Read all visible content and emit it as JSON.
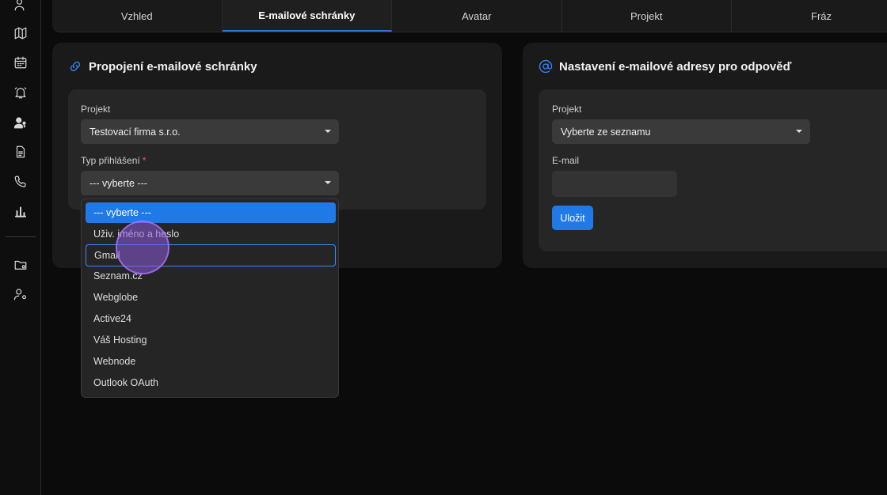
{
  "tabs": [
    {
      "label": "Vzhled",
      "active": false
    },
    {
      "label": "E-mailové schránky",
      "active": true
    },
    {
      "label": "Avatar",
      "active": false
    },
    {
      "label": "Projekt",
      "active": false
    },
    {
      "label": "Fráz",
      "active": false
    }
  ],
  "sidebar": {
    "icons": [
      "user-icon",
      "map-icon",
      "calendar-icon",
      "bell-icon",
      "user-key-icon",
      "document-icon",
      "phone-icon",
      "bar-chart-icon",
      "folder-settings-icon",
      "user-settings-icon"
    ]
  },
  "left_card": {
    "title": "Propojení e-mailové schránky",
    "project_label": "Projekt",
    "project_value": "Testovací firma s.r.o.",
    "login_type_label": "Typ přihlášení",
    "required_mark": "*",
    "login_type_value": "--- vyberte ---"
  },
  "dropdown": {
    "options": [
      "--- vyberte ---",
      "Uživ. jméno a heslo",
      "Gmail",
      "Seznam.cz",
      "Webglobe",
      "Active24",
      "Váš Hosting",
      "Webnode",
      "Outlook OAuth"
    ],
    "selected_index": 0,
    "focused_index": 2
  },
  "right_card": {
    "title": "Nastavení e-mailové adresy pro odpověď",
    "project_label": "Projekt",
    "project_value": "Vyberte ze seznamu",
    "email_label": "E-mail",
    "email_value": "",
    "save_label": "Uložit"
  },
  "colors": {
    "accent": "#1f7ae8",
    "background": "#0b0b0b",
    "required": "#ff4d4f"
  }
}
